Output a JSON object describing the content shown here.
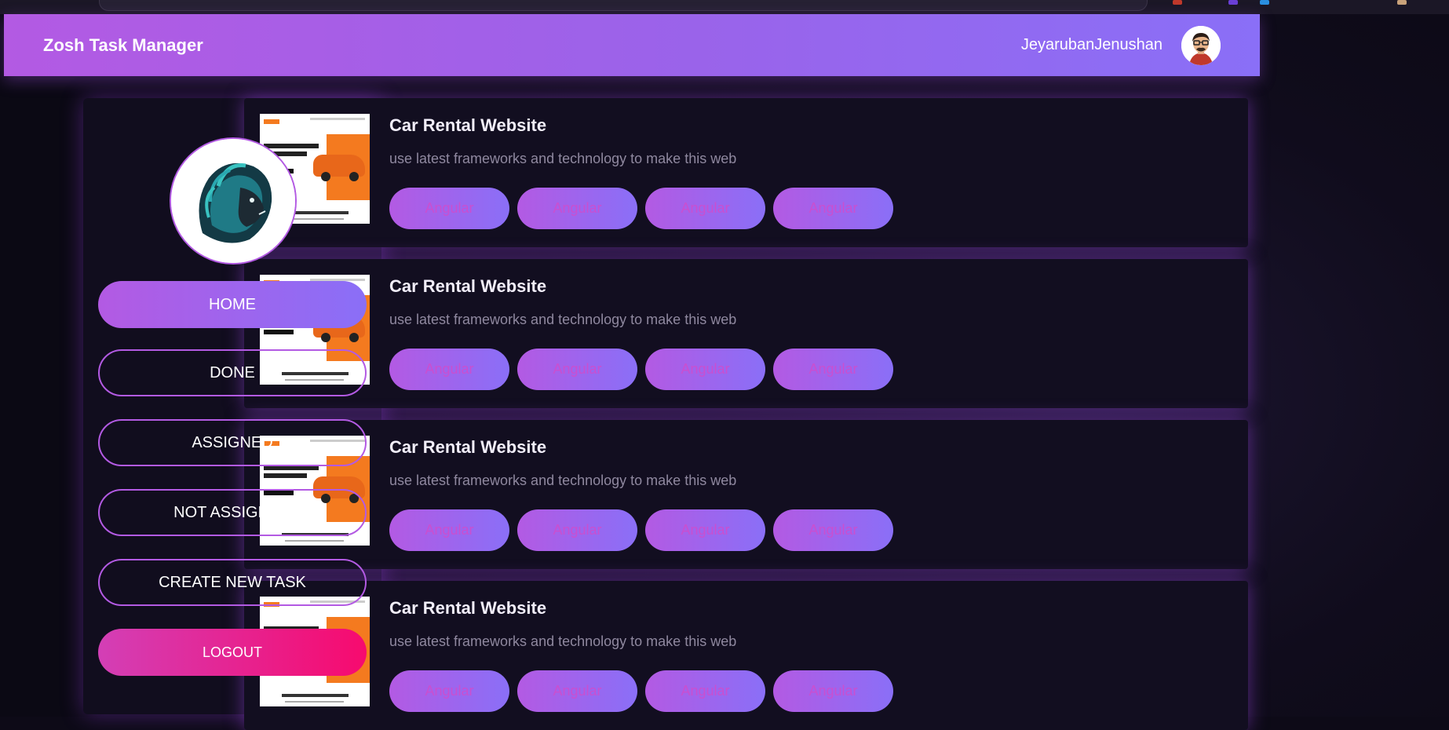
{
  "header": {
    "brand": "Zosh Task Manager",
    "username": "JeyarubanJenushan"
  },
  "sidebar": {
    "items": [
      {
        "label": "HOME",
        "active": true
      },
      {
        "label": "DONE"
      },
      {
        "label": "ASSIGNED"
      },
      {
        "label": "NOT ASSIGNED"
      },
      {
        "label": "CREATE NEW TASK"
      }
    ],
    "logout_label": "LOGOUT"
  },
  "tasks": [
    {
      "title": "Car Rental Website",
      "description": "use latest frameworks and technology to make this web",
      "tags": [
        "Angular",
        "Angular",
        "Angular",
        "Angular"
      ]
    },
    {
      "title": "Car Rental Website",
      "description": "use latest frameworks and technology to make this web",
      "tags": [
        "Angular",
        "Angular",
        "Angular",
        "Angular"
      ]
    },
    {
      "title": "Car Rental Website",
      "description": "use latest frameworks and technology to make this web",
      "tags": [
        "Angular",
        "Angular",
        "Angular",
        "Angular"
      ]
    },
    {
      "title": "Car Rental Website",
      "description": "use latest frameworks and technology to make this web",
      "tags": [
        "Angular",
        "Angular",
        "Angular",
        "Angular"
      ]
    }
  ],
  "colors": {
    "accent_start": "#b35ae3",
    "accent_end": "#8a6ff7",
    "logout_start": "#d33fb6",
    "logout_end": "#f70a6e",
    "background": "#0d0a17"
  }
}
